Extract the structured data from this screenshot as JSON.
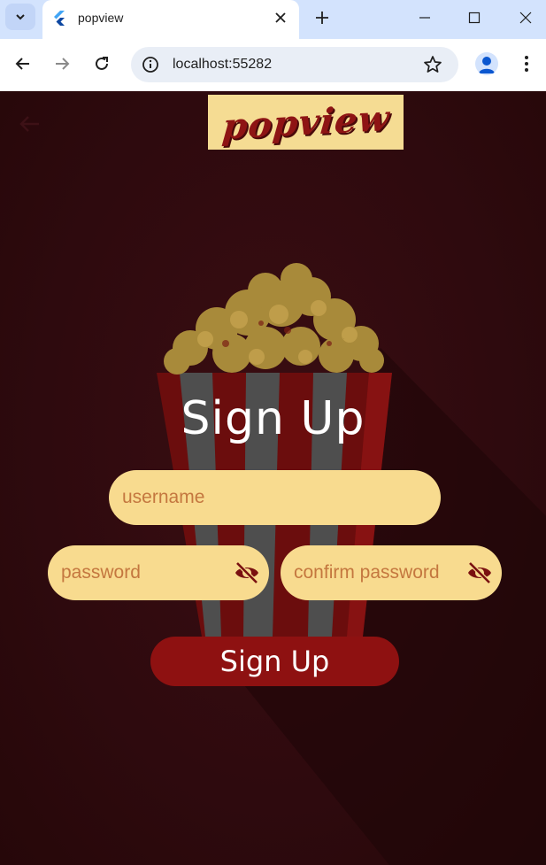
{
  "browser": {
    "tab_title": "popview",
    "url": "localhost:55282"
  },
  "app": {
    "logo_text": "popview",
    "heading": "Sign Up",
    "username_placeholder": "username",
    "password_placeholder": "password",
    "confirm_placeholder": "confirm password",
    "submit_label": "Sign Up"
  },
  "icons": {
    "back": "arrow-back-icon",
    "password_toggle": "eye-off-icon",
    "confirm_toggle": "eye-off-icon"
  },
  "colors": {
    "background": "#2e0a0e",
    "field": "#f8db8f",
    "placeholder": "#c4773f",
    "button": "#8e1111",
    "logo_bg": "#f5dc93",
    "logo_text": "#8e1414"
  }
}
